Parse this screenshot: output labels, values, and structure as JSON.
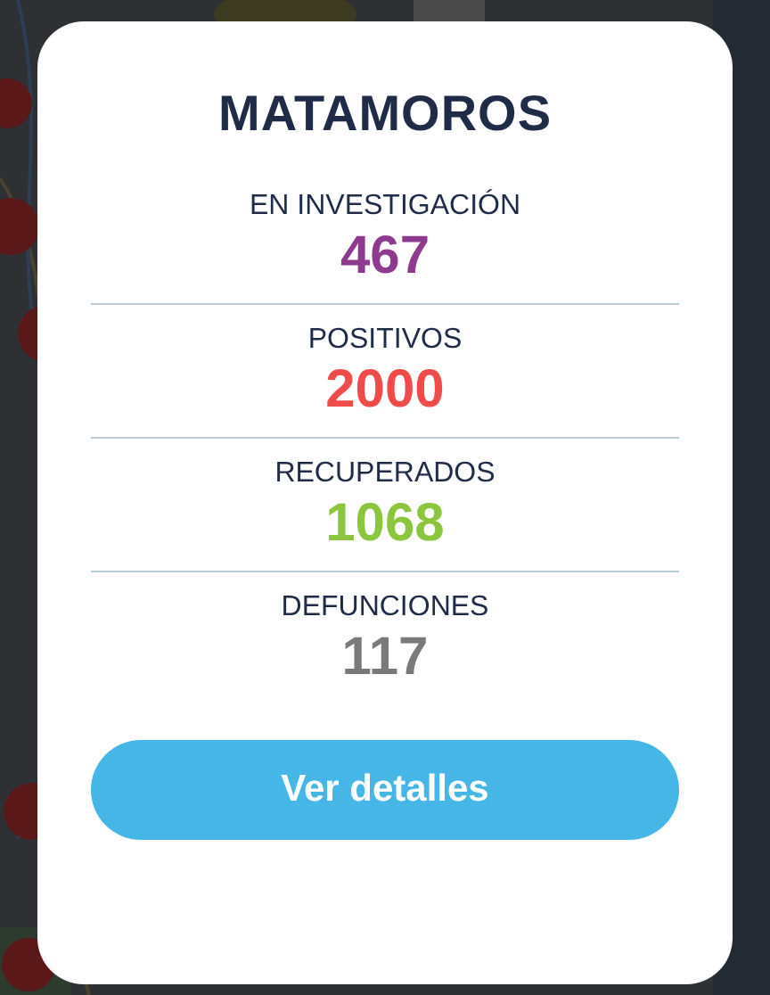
{
  "dialog": {
    "title": "MATAMOROS",
    "stats": [
      {
        "label": "EN INVESTIGACIÓN",
        "value": "467",
        "color": "#8e3a8e"
      },
      {
        "label": "POSITIVOS",
        "value": "2000",
        "color": "#f04b4b"
      },
      {
        "label": "RECUPERADOS",
        "value": "1068",
        "color": "#8cc63f"
      },
      {
        "label": "DEFUNCIONES",
        "value": "117",
        "color": "#7a7a7a"
      }
    ],
    "button": "Ver detalles"
  }
}
